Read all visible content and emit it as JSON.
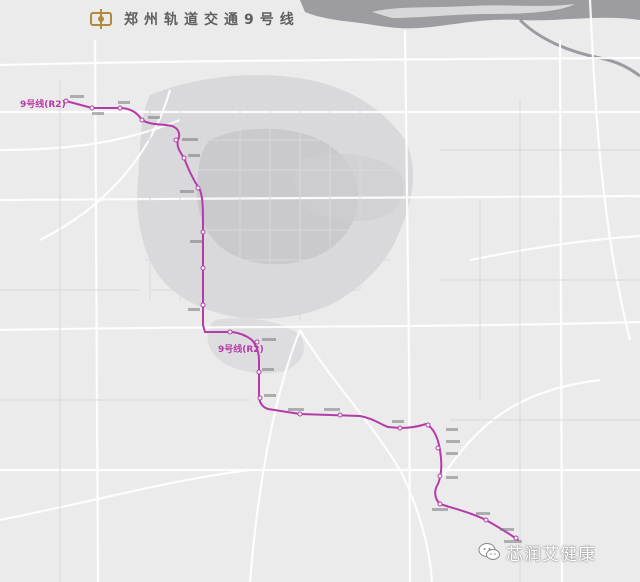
{
  "map": {
    "title": "郑州轨道交通9号线",
    "line_label_top": "9号线(R2)",
    "line_label_mid": "9号线(R2)",
    "line_color": "#b43ba8",
    "river_color": "#8e8e94",
    "background_color": "#ecebec",
    "logo_icon": "metro-logo-icon"
  },
  "watermark": {
    "icon": "wechat-icon",
    "text": "芯润艾健康"
  }
}
